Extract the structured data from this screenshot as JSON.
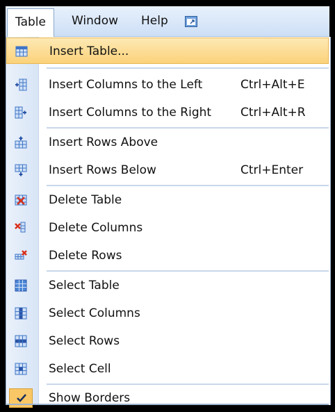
{
  "menubar": {
    "items": [
      {
        "label": "Table"
      },
      {
        "label": "Window"
      },
      {
        "label": "Help"
      }
    ]
  },
  "menu": {
    "items": [
      {
        "label": "Insert Table...",
        "shortcut": "",
        "icon": "insert-table-icon",
        "highlighted": true
      },
      {
        "label": "Insert Columns to the Left",
        "shortcut": "Ctrl+Alt+E",
        "icon": "insert-columns-left-icon"
      },
      {
        "label": "Insert Columns to the Right",
        "shortcut": "Ctrl+Alt+R",
        "icon": "insert-columns-right-icon"
      },
      {
        "label": "Insert Rows Above",
        "shortcut": "",
        "icon": "insert-rows-above-icon"
      },
      {
        "label": "Insert Rows Below",
        "shortcut": "Ctrl+Enter",
        "icon": "insert-rows-below-icon"
      },
      {
        "label": "Delete Table",
        "shortcut": "",
        "icon": "delete-table-icon"
      },
      {
        "label": "Delete Columns",
        "shortcut": "",
        "icon": "delete-columns-icon"
      },
      {
        "label": "Delete Rows",
        "shortcut": "",
        "icon": "delete-rows-icon"
      },
      {
        "label": "Select Table",
        "shortcut": "",
        "icon": "select-table-icon"
      },
      {
        "label": "Select Columns",
        "shortcut": "",
        "icon": "select-columns-icon"
      },
      {
        "label": "Select Rows",
        "shortcut": "",
        "icon": "select-rows-icon"
      },
      {
        "label": "Select Cell",
        "shortcut": "",
        "icon": "select-cell-icon"
      },
      {
        "label": "Show Borders",
        "shortcut": "",
        "icon": "checkmark-icon",
        "checked": true
      }
    ]
  },
  "colors": {
    "highlight": "#fbd27a",
    "gutter": "#d8e5f6",
    "check_bg": "#f9c766",
    "icon_blue": "#3d74c6",
    "icon_red": "#d9301c"
  }
}
